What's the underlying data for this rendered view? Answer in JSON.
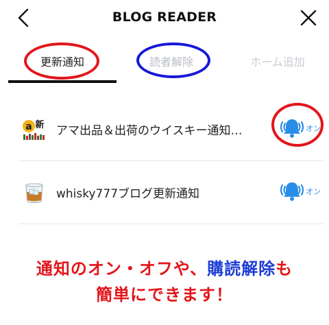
{
  "header": {
    "title": "BLOG READER"
  },
  "tabs": [
    {
      "label": "更新通知",
      "active": true
    },
    {
      "label": "読者解除",
      "active": false
    },
    {
      "label": "ホーム追加",
      "active": false
    }
  ],
  "subscriptions": [
    {
      "name": "アマ出品＆出荷のウイスキー通知…",
      "icon": "amazon-new-whisky-icon",
      "notify_state": "オン"
    },
    {
      "name": "whisky777ブログ更新通知",
      "icon": "whisky-glass-icon",
      "notify_state": "オン"
    }
  ],
  "caption": {
    "line1_part1": "通知のオン・オフや、",
    "line1_part2": "購読解除",
    "line1_part3": "も",
    "line2": "簡単にできます！"
  },
  "colors": {
    "accent_blue": "#2a8ee8",
    "annotation_red": "#e3151a",
    "annotation_blue": "#1518d9",
    "inactive_tab": "#b8bcc4"
  }
}
